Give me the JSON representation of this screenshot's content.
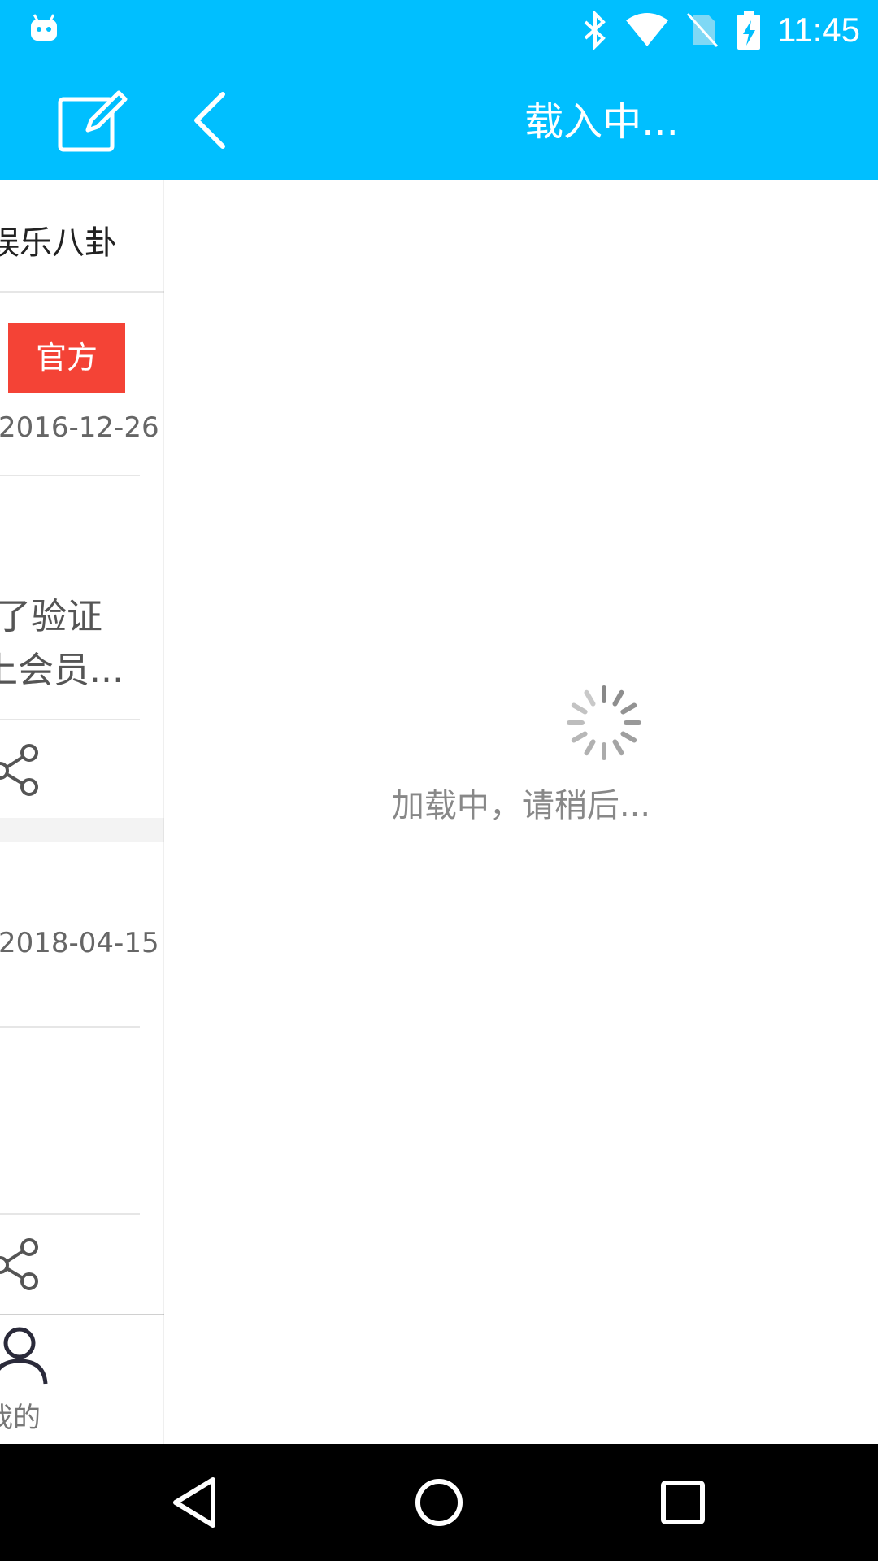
{
  "status_bar": {
    "time": "11:45",
    "icons": [
      "android-notification-icon",
      "bluetooth-icon",
      "wifi-icon",
      "no-sim-icon",
      "battery-charging-icon"
    ]
  },
  "app_bar": {
    "title": "载入中...",
    "edit_icon": "edit-icon",
    "back_icon": "back-arrow-icon"
  },
  "left_list": {
    "category": "娱乐八卦",
    "badge": "官方",
    "date1": "2016-12-26",
    "snippet_line1": "了验证",
    "snippet_line2": "上会员...",
    "date2": "2018-04-15",
    "share_icon": "share-icon",
    "tab_label": "我的",
    "tab_icon": "user-icon"
  },
  "loading": {
    "text": "加载中，请稍后..."
  },
  "colors": {
    "accent": "#00BFFF",
    "badge_bg": "#F44336",
    "loading_text": "#888888"
  }
}
